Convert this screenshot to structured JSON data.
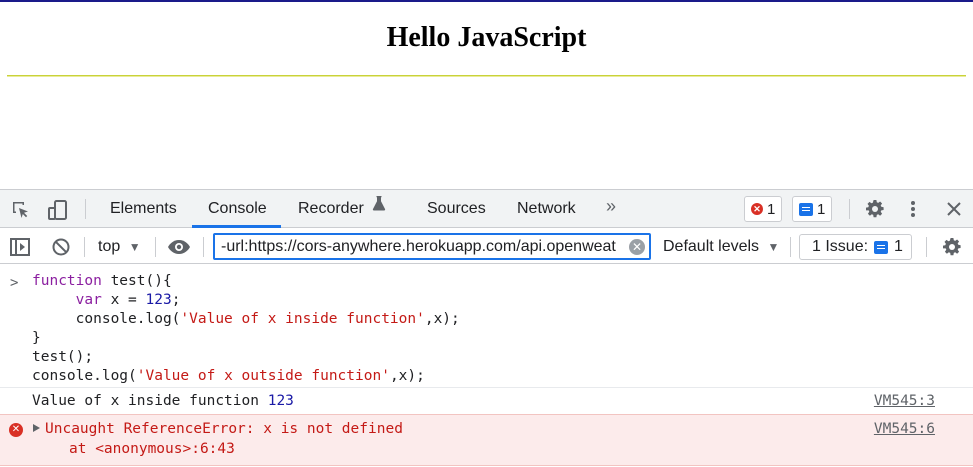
{
  "page": {
    "heading": "Hello JavaScript"
  },
  "devtools": {
    "tabs": [
      "Elements",
      "Console",
      "Recorder",
      "Sources",
      "Network"
    ],
    "active_tab": "Console",
    "more_tabs_glyph": "»",
    "error_count": "1",
    "message_count": "1",
    "context_selector": "top",
    "filter_value": "-url:https://cors-anywhere.herokuapp.com/api.openweat",
    "levels_label": "Default levels",
    "issues_label": "1 Issue:",
    "issues_count": "1",
    "icons": {
      "inspect": "inspect-element-icon",
      "device": "device-toolbar-icon",
      "recorder": "flask-icon",
      "settings": "gear-icon",
      "more": "kebab-icon",
      "close": "close-icon",
      "sidebar": "sidebar-toggle-icon",
      "clear": "block-icon",
      "live": "eye-icon"
    },
    "colors": {
      "accent": "#1a73e8",
      "error": "#d93025",
      "error_bg": "#fcebeb"
    }
  },
  "console": {
    "input_lines": [
      "function test(){",
      "     var x = 123;",
      "     console.log('Value of x inside function',x);",
      "}",
      "test();",
      "console.log('Value of x outside function',x);"
    ],
    "log": {
      "text": "Value of x inside function",
      "value": "123",
      "source": "VM545:3"
    },
    "error": {
      "message": "Uncaught ReferenceError: x is not defined",
      "stack": "at <anonymous>:6:43",
      "source": "VM545:6"
    }
  }
}
